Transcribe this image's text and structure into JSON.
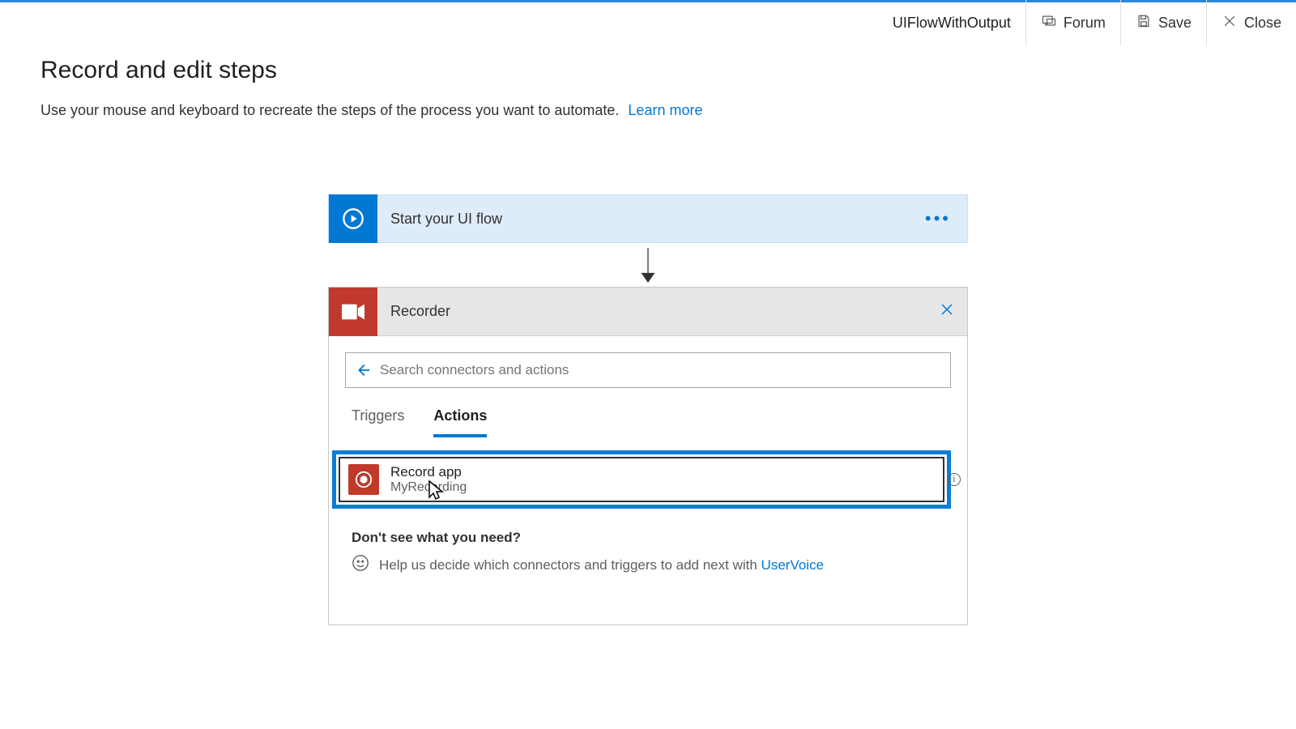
{
  "topbar": {
    "title": "UIFlowWithOutput",
    "forum": "Forum",
    "save": "Save",
    "close": "Close"
  },
  "page": {
    "title": "Record and edit steps",
    "subtitle": "Use your mouse and keyboard to recreate the steps of the process you want to automate.",
    "learn_more": "Learn more"
  },
  "flow": {
    "start_label": "Start your UI flow"
  },
  "recorder": {
    "title": "Recorder",
    "search_placeholder": "Search connectors and actions",
    "tabs": {
      "triggers": "Triggers",
      "actions": "Actions",
      "active": "actions"
    },
    "action": {
      "title": "Record app",
      "subtitle": "MyRecording"
    },
    "help": {
      "title": "Don't see what you need?",
      "text": "Help us decide which connectors and triggers to add next with ",
      "link": "UserVoice"
    }
  }
}
